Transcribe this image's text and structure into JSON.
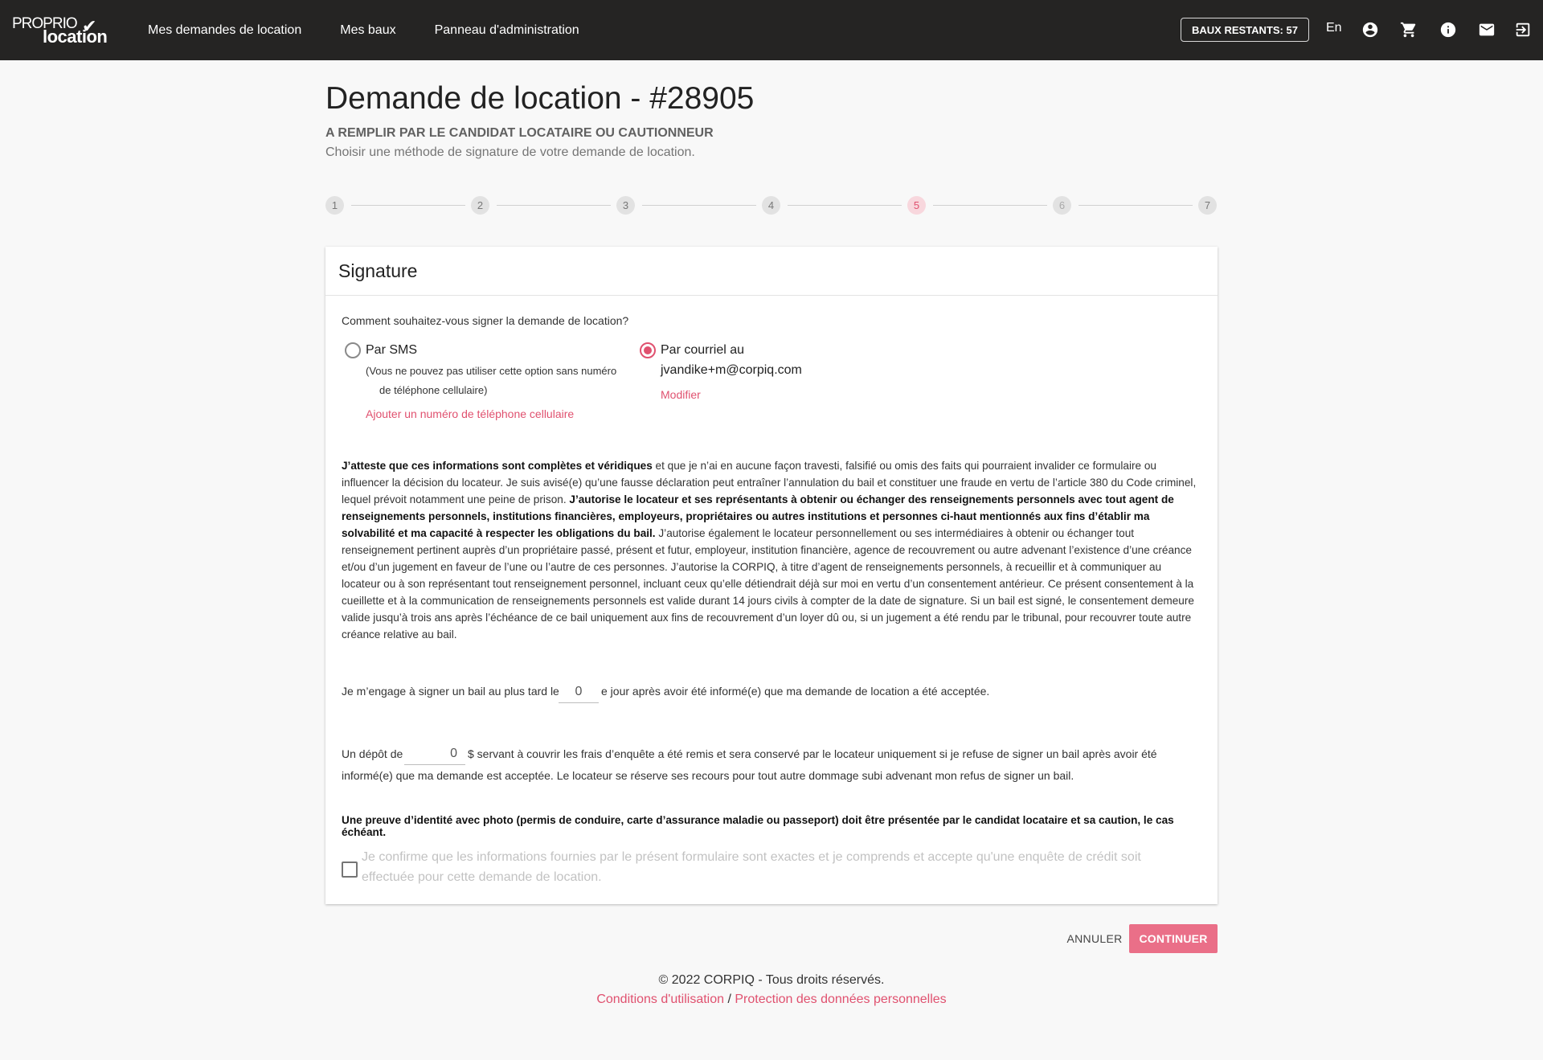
{
  "header": {
    "logo_top": "PROPRIO",
    "logo_bottom": "location",
    "nav": [
      "Mes demandes de location",
      "Mes baux",
      "Panneau d'administration"
    ],
    "badge": "BAUX RESTANTS: 57",
    "language": "En",
    "icons": [
      "account-circle-icon",
      "cart-icon",
      "info-icon",
      "mail-icon",
      "logout-icon"
    ]
  },
  "page": {
    "title": "Demande de location - #28905",
    "subtitle": "A REMPLIR PAR LE CANDIDAT LOCATAIRE OU CAUTIONNEUR",
    "description": "Choisir une méthode de signature de votre demande de location."
  },
  "stepper": {
    "steps": [
      "1",
      "2",
      "3",
      "4",
      "5",
      "6",
      "7"
    ],
    "active_step": 5
  },
  "card": {
    "title": "Signature",
    "question": "Comment souhaitez-vous signer la demande de location?",
    "sms": {
      "label": "Par SMS",
      "note_line1": "(Vous ne pouvez pas utiliser cette option sans numéro",
      "note_line2": "de téléphone cellulaire)",
      "link": "Ajouter un numéro de téléphone cellulaire",
      "selected": false
    },
    "email": {
      "label": "Par courriel au",
      "address": "jvandike+m@corpiq.com",
      "link": "Modifier",
      "selected": true
    },
    "legal": {
      "bold1": "J’atteste que ces informations sont complètes et véridiques",
      "text1": " et que je n’ai en aucune façon travesti, falsifié ou omis des faits qui pourraient invalider ce formulaire ou influencer la décision du locateur. Je suis avisé(e) qu’une fausse déclaration peut entraîner l’annulation du bail et constituer une fraude en vertu de l’article 380 du Code criminel, lequel prévoit notamment une peine de prison. ",
      "bold2": "J’autorise le locateur et ses représentants à obtenir ou échanger des renseignements personnels avec tout agent de renseignements personnels, institutions financières, employeurs, propriétaires ou autres institutions et personnes ci-haut mentionnés aux fins d’établir ma solvabilité et ma capacité à respecter les obligations du bail.",
      "text2": " J’autorise également le locateur personnellement ou ses intermédiaires à obtenir ou échanger tout renseignement pertinent auprès d’un propriétaire passé, présent et futur, employeur, institution financière, agence de recouvrement ou autre advenant l’existence d’une créance et/ou d’un jugement en faveur de l’une ou l’autre de ces personnes. J’autorise la CORPIQ, à titre d’agent de renseignements personnels, à recueillir et à communiquer au locateur ou à son représentant tout renseignement personnel, incluant ceux qu’elle détiendrait déjà sur moi en vertu d’un consentement antérieur. Ce présent consentement à la cueillette et à la communication de renseignements personnels est valide durant 14 jours civils à compter de la date de signature. Si un bail est signé, le consentement demeure valide jusqu’à trois ans après l’échéance de ce bail uniquement aux fins de recouvrement d’un loyer dû ou, si un jugement a été rendu par le tribunal, pour recouvrer toute autre créance relative au bail."
    },
    "engage": {
      "before": "Je m’engage à signer un bail au plus tard le",
      "value": "0",
      "after": "e jour après avoir été informé(e) que ma demande de location a été acceptée."
    },
    "deposit": {
      "before": "Un dépôt de",
      "value": "0",
      "after": "$ servant à couvrir les frais d’enquête a été remis et sera conservé par le locateur uniquement si je refuse de signer un bail après avoir été",
      "line2": "informé(e) que ma demande est acceptée. Le locateur se réserve ses recours pour tout autre dommage subi advenant mon refus de signer un bail."
    },
    "proof": "Une preuve d’identité avec photo (permis de conduire, carte d’assurance maladie ou passeport) doit être présentée par le candidat locataire et sa caution, le cas échéant.",
    "confirm": "Je confirme que les informations fournies par le présent formulaire sont exactes et je comprends et accepte qu'une enquête de crédit soit effectuée pour cette demande de location."
  },
  "actions": {
    "cancel": "ANNULER",
    "continue": "CONTINUER"
  },
  "footer": {
    "copyright": "© 2022 CORPIQ - Tous droits réservés.",
    "terms": "Conditions d'utilisation",
    "separator": " / ",
    "privacy": "Protection des données personnelles"
  },
  "colors": {
    "header_bg": "#252423",
    "accent": "#e0516f",
    "continue_bg": "#ea6f88"
  }
}
